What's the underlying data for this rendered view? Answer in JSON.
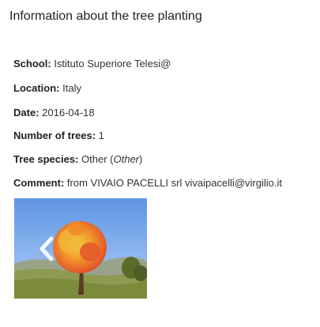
{
  "page": {
    "title": "Information about the tree planting"
  },
  "details": {
    "school": {
      "label": "School:",
      "value": "Istituto Superiore Telesi@"
    },
    "location": {
      "label": "Location:",
      "value": "Italy"
    },
    "date": {
      "label": "Date:",
      "value": "2016-04-18"
    },
    "trees": {
      "label": "Number of trees:",
      "value": "1"
    },
    "species": {
      "label": "Tree species:",
      "value": "Other",
      "value_open": " (",
      "value_italic": "Other",
      "value_close": ")"
    },
    "comment": {
      "label": "Comment:",
      "value": "from VIVAIO PACELLI srl vivaipacelli@virgilio.it"
    }
  },
  "gallery": {
    "prev_icon": "chevron-left-icon",
    "colors": {
      "sky": "#7aa8ea",
      "foliage_red": "#e0472a",
      "foliage_orange": "#f19a2b",
      "foliage_yellow": "#f5d142",
      "grass": "#7c8a3c"
    }
  }
}
